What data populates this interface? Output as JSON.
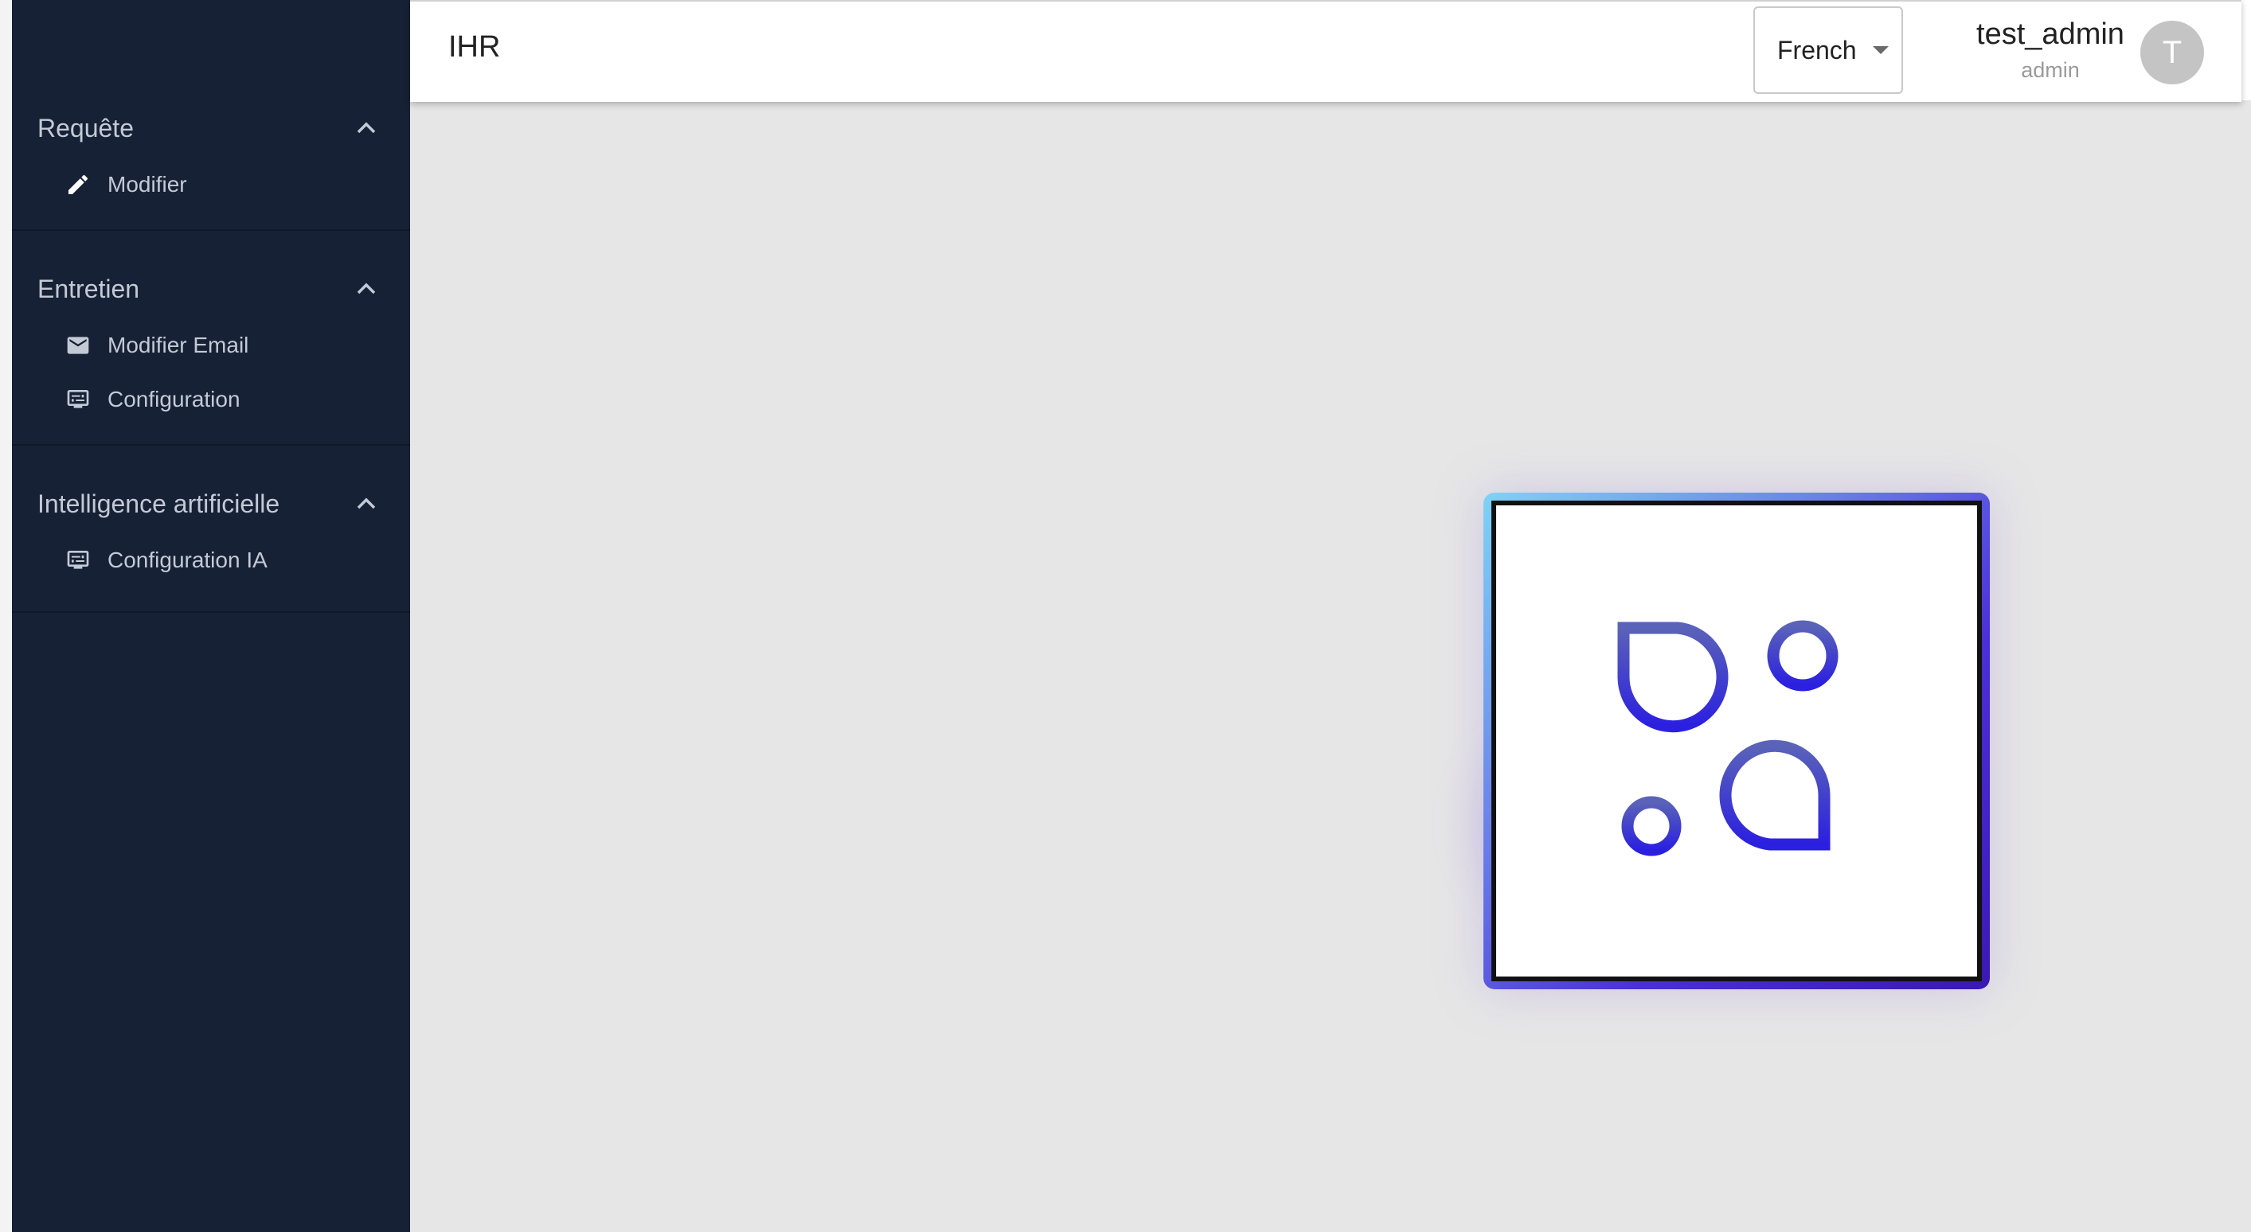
{
  "app": {
    "title": "IHR"
  },
  "header": {
    "language": {
      "selected": "French"
    },
    "user": {
      "name": "test_admin",
      "role": "admin",
      "avatar_initial": "T"
    }
  },
  "sidebar": {
    "sections": [
      {
        "title": "Requête",
        "items": [
          {
            "label": "Modifier",
            "icon": "pencil-icon"
          }
        ]
      },
      {
        "title": "Entretien",
        "items": [
          {
            "label": "Modifier Email",
            "icon": "mail-icon"
          },
          {
            "label": "Configuration",
            "icon": "display-settings-icon"
          }
        ]
      },
      {
        "title": "Intelligence artificielle",
        "items": [
          {
            "label": "Configuration IA",
            "icon": "display-settings-icon"
          }
        ]
      }
    ]
  },
  "colors": {
    "sidebar_bg": "#172135",
    "main_bg": "#e6e6e6",
    "logo_gradient_start": "#7fd3f5",
    "logo_gradient_end": "#3b18b5",
    "logo_mark_top": "#5a63b8",
    "logo_mark_bottom": "#2b1fe0"
  }
}
